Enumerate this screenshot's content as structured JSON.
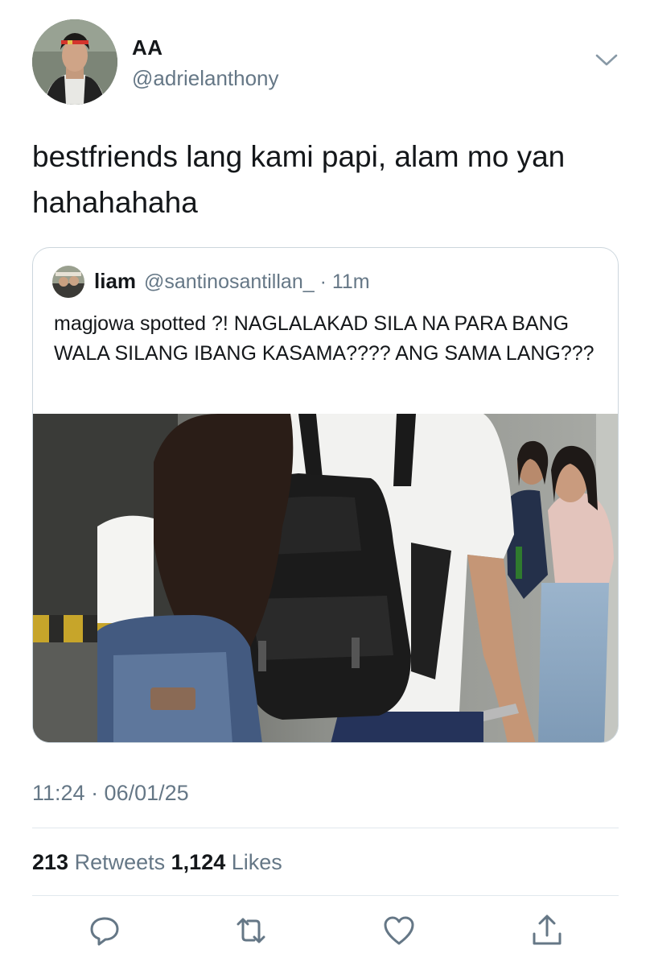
{
  "tweet": {
    "author": {
      "name": "AA",
      "handle": "@adrielanthony"
    },
    "text": "bestfriends lang kami papi, alam mo yan hahahahaha",
    "timestamp": "11:24 · 06/01/25",
    "stats": {
      "retweets_count": "213",
      "retweets_label": "Retweets",
      "likes_count": "1,124",
      "likes_label": "Likes"
    }
  },
  "quoted": {
    "author": {
      "name": "liam",
      "handle_time": "@santinosantillan_ · 11m"
    },
    "text": "magjowa spotted ?! NAGLALAKAD SILA NA PARA BANG WALA SILANG IBANG KASAMA???? ANG SAMA LANG???"
  },
  "icons": {
    "menu": "chevron-down-icon",
    "reply": "reply-icon",
    "retweet": "retweet-icon",
    "like": "heart-icon",
    "share": "share-icon"
  },
  "colors": {
    "secondary_text": "#657786",
    "primary_text": "#14171a",
    "border": "#ccd6dd"
  }
}
